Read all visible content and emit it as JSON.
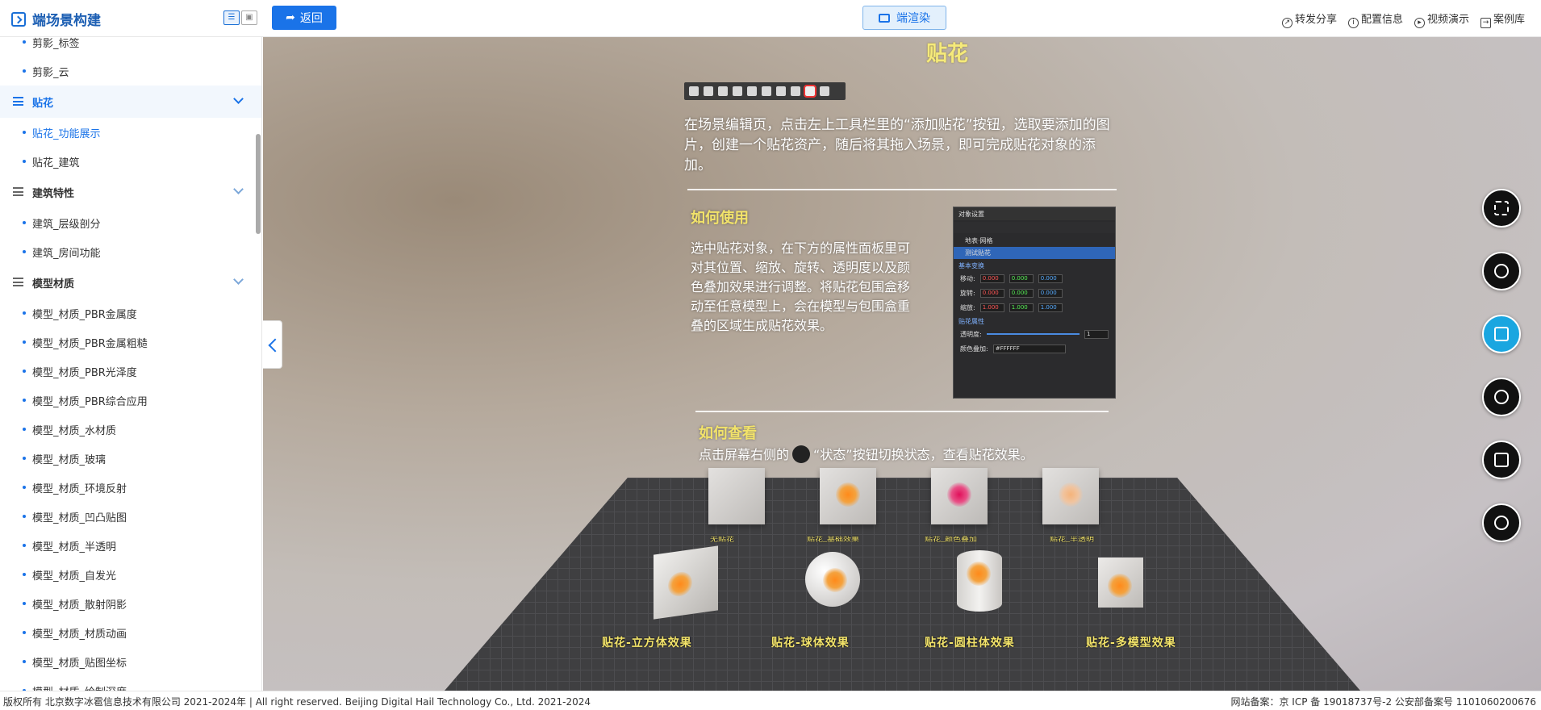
{
  "app": {
    "title": "端场景构建"
  },
  "header": {
    "back_label": "返回",
    "render_label": "端渲染",
    "links": [
      {
        "icon": "share-icon",
        "label": "转发分享"
      },
      {
        "icon": "info-icon",
        "label": "配置信息"
      },
      {
        "icon": "play-icon",
        "label": "视频演示"
      },
      {
        "icon": "exit-icon",
        "label": "案例库"
      }
    ]
  },
  "sidebar": {
    "items": [
      {
        "type": "child",
        "label": "剪影_标签"
      },
      {
        "type": "child",
        "label": "剪影_云"
      },
      {
        "type": "group",
        "label": "贴花",
        "open": true
      },
      {
        "type": "child",
        "label": "贴花_功能展示",
        "active": true
      },
      {
        "type": "child",
        "label": "贴花_建筑"
      },
      {
        "type": "group",
        "label": "建筑特性"
      },
      {
        "type": "child",
        "label": "建筑_层级剖分"
      },
      {
        "type": "child",
        "label": "建筑_房间功能"
      },
      {
        "type": "group",
        "label": "模型材质"
      },
      {
        "type": "child",
        "label": "模型_材质_PBR金属度"
      },
      {
        "type": "child",
        "label": "模型_材质_PBR金属粗糙"
      },
      {
        "type": "child",
        "label": "模型_材质_PBR光泽度"
      },
      {
        "type": "child",
        "label": "模型_材质_PBR综合应用"
      },
      {
        "type": "child",
        "label": "模型_材质_水材质"
      },
      {
        "type": "child",
        "label": "模型_材质_玻璃"
      },
      {
        "type": "child",
        "label": "模型_材质_环境反射"
      },
      {
        "type": "child",
        "label": "模型_材质_凹凸贴图"
      },
      {
        "type": "child",
        "label": "模型_材质_半透明"
      },
      {
        "type": "child",
        "label": "模型_材质_自发光"
      },
      {
        "type": "child",
        "label": "模型_材质_散射阴影"
      },
      {
        "type": "child",
        "label": "模型_材质_材质动画"
      },
      {
        "type": "child",
        "label": "模型_材质_贴图坐标"
      },
      {
        "type": "child",
        "label": "模型_材质_绘制深度"
      }
    ]
  },
  "scene": {
    "title": "贴花",
    "intro": "在场景编辑页，点击左上工具栏里的“添加贴花”按钮，选取要添加的图片，创建一个贴花资产，随后将其拖入场景，即可完成贴花对象的添加。",
    "how_use_title": "如何使用",
    "how_use_body": "选中贴花对象，在下方的属性面板里可对其位置、缩放、旋转、透明度以及颜色叠加效果进行调整。将贴花包围盒移动至任意模型上，会在模型与包围盒重叠的区域生成贴花效果。",
    "how_view_title": "如何查看",
    "how_view_pre": "点击屏幕右侧的",
    "how_view_post": "“状态”按钮切换状态，查看贴花效果。",
    "panel": {
      "title": "对象设置",
      "row1": "地表·网格",
      "row2": "测试贴花",
      "sec1": "基本变换",
      "move": "移动:",
      "rotate": "旋转:",
      "scale": "缩放:",
      "v0": "0.000",
      "v1": "1.000",
      "sec2": "贴花属性",
      "opacity": "透明度:",
      "opacity_val": "1",
      "color": "颜色叠加:",
      "color_val": "#FFFFFF"
    },
    "captions_back": [
      "无贴花",
      "贴花_基础效果",
      "贴花_颜色叠加",
      "贴花_半透明"
    ],
    "captions_front": [
      "贴花-立方体效果",
      "贴花-球体效果",
      "贴花-圆柱体效果",
      "贴花-多模型效果"
    ]
  },
  "right_controls": [
    {
      "icon": "fullscreen-icon"
    },
    {
      "icon": "reset-view-icon"
    },
    {
      "icon": "video-camera-icon",
      "active": true
    },
    {
      "icon": "weather-icon"
    },
    {
      "icon": "state-grid-icon"
    },
    {
      "icon": "info-icon"
    }
  ],
  "footer": {
    "left": "版权所有 北京数字冰雹信息技术有限公司 2021-2024年 | All right reserved. Beijing Digital Hail Technology Co., Ltd. 2021-2024",
    "right": "网站备案：京 ICP 备 19018737号-2 公安部备案号 1101060200676"
  }
}
